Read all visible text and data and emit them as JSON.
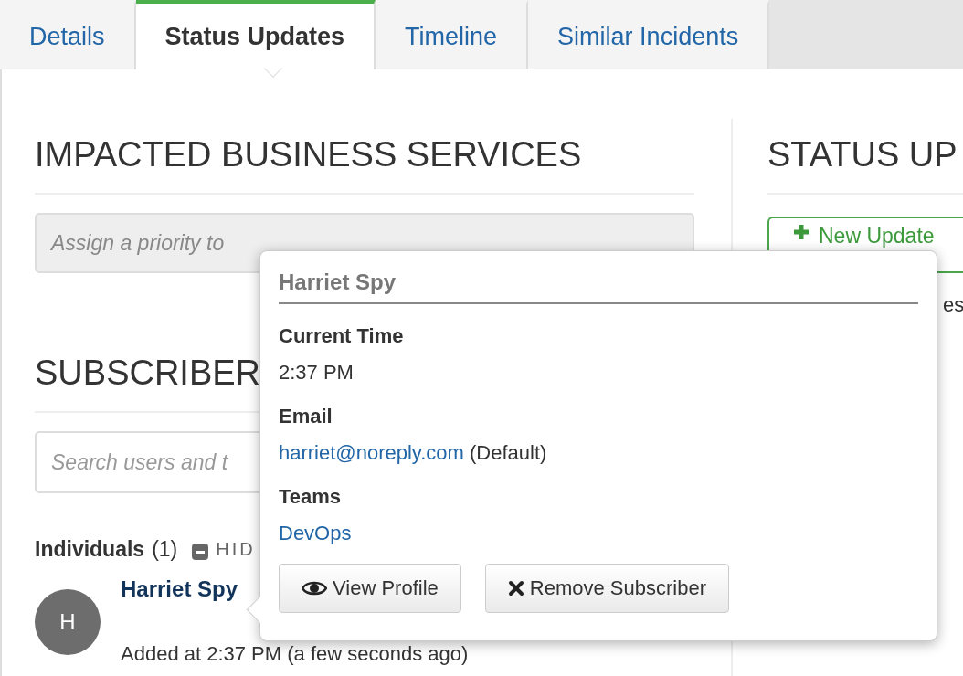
{
  "tabs": [
    {
      "label": "Details",
      "selected": false
    },
    {
      "label": "Status Updates",
      "selected": true
    },
    {
      "label": "Timeline",
      "selected": false
    },
    {
      "label": "Similar Incidents",
      "selected": false
    }
  ],
  "impacted_services": {
    "title": "IMPACTED BUSINESS SERVICES",
    "notice": "Assign a priority to"
  },
  "subscribers": {
    "title": "SUBSCRIBER",
    "search": {
      "placeholder": "Search users and t"
    },
    "individuals": {
      "label": "Individuals",
      "count": "(1)",
      "toggle": "HID"
    },
    "people": [
      {
        "initial": "H",
        "name": "Harriet Spy",
        "added": "Added at 2:37 PM (a few seconds ago)"
      }
    ]
  },
  "status_updates": {
    "title": "STATUS UP",
    "new_button": "New Update",
    "column_text": "es"
  },
  "popover": {
    "name": "Harriet Spy",
    "sections": [
      {
        "label": "Current Time",
        "kind": "text",
        "value": "2:37 PM"
      },
      {
        "label": "Email",
        "kind": "email",
        "link": "harriet@noreply.com",
        "note": "(Default)"
      },
      {
        "label": "Teams",
        "kind": "link",
        "link": "DevOps"
      }
    ],
    "buttons": [
      {
        "label": "View Profile"
      },
      {
        "label": "Remove Subscriber"
      }
    ]
  }
}
